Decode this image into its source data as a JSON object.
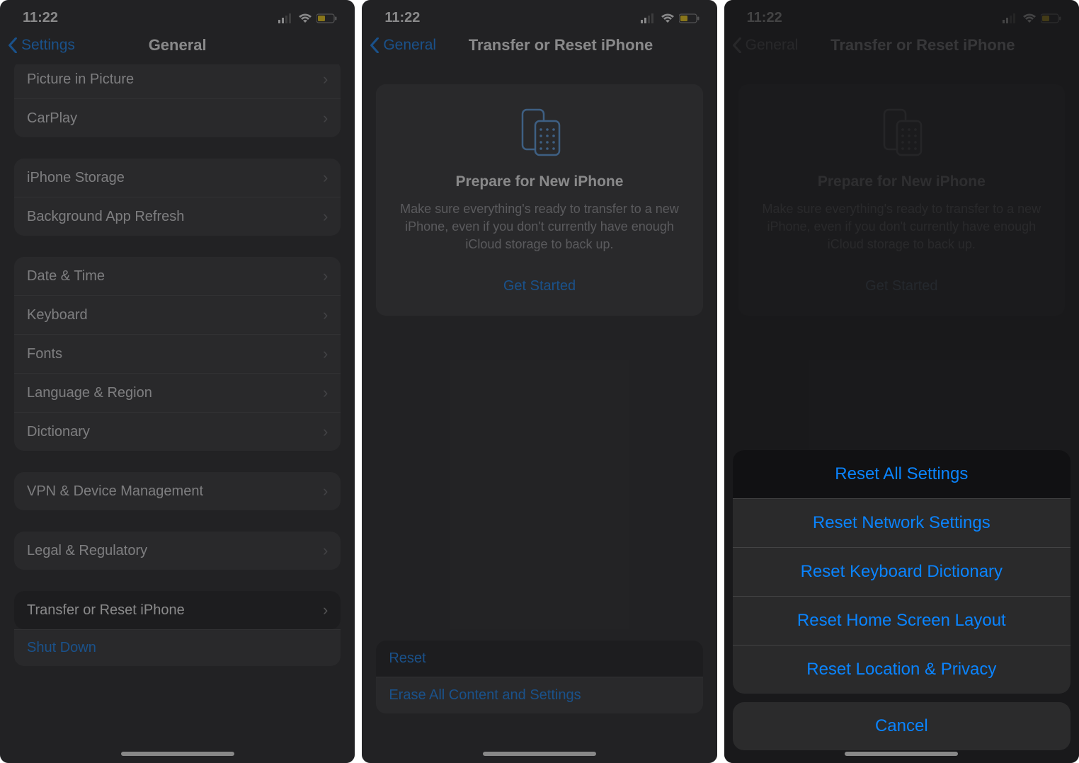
{
  "status": {
    "time": "11:22"
  },
  "screen1": {
    "back": "Settings",
    "title": "General",
    "group1": [
      "Picture in Picture",
      "CarPlay"
    ],
    "group2": [
      "iPhone Storage",
      "Background App Refresh"
    ],
    "group3": [
      "Date & Time",
      "Keyboard",
      "Fonts",
      "Language & Region",
      "Dictionary"
    ],
    "group4": [
      "VPN & Device Management"
    ],
    "group5": [
      "Legal & Regulatory"
    ],
    "transfer": "Transfer or Reset iPhone",
    "shutdown": "Shut Down"
  },
  "screen2": {
    "back": "General",
    "title": "Transfer or Reset iPhone",
    "card_title": "Prepare for New iPhone",
    "card_body": "Make sure everything's ready to transfer to a new iPhone, even if you don't currently have enough iCloud storage to back up.",
    "get_started": "Get Started",
    "reset": "Reset",
    "erase": "Erase All Content and Settings"
  },
  "screen3": {
    "back": "General",
    "title": "Transfer or Reset iPhone",
    "card_title": "Prepare for New iPhone",
    "card_body": "Make sure everything's ready to transfer to a new iPhone, even if you don't currently have enough iCloud storage to back up.",
    "get_started": "Get Started",
    "sheet": [
      "Reset All Settings",
      "Reset Network Settings",
      "Reset Keyboard Dictionary",
      "Reset Home Screen Layout",
      "Reset Location & Privacy"
    ],
    "cancel": "Cancel"
  }
}
